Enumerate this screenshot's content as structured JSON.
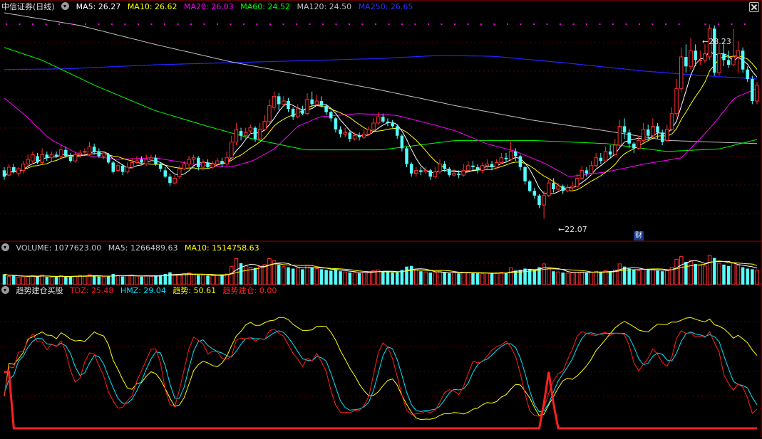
{
  "window": {
    "title": "中信证券(日线)"
  },
  "colors": {
    "up": "#ff3030",
    "down": "#54ffff",
    "ma5": "#ffffff",
    "ma10": "#ffff00",
    "ma20": "#ff00ff",
    "ma60": "#00ff00",
    "ma120": "#c0c0c0",
    "ma250": "#0000ff",
    "tdz": "#ff2020",
    "hmz": "#00e5ff",
    "qushi": "#ffff00",
    "jiancang": "#ff2020"
  },
  "price_panel": {
    "legend": [
      {
        "label": "MA5: 26.27",
        "color": "#ffffff"
      },
      {
        "label": "MA10: 26.62",
        "color": "#ffff00"
      },
      {
        "label": "MA20: 26.03",
        "color": "#ff00ff"
      },
      {
        "label": "MA60: 24.52",
        "color": "#00ff00"
      },
      {
        "label": "MA120: 24.50",
        "color": "#c0c0c0"
      },
      {
        "label": "MA250: 26.65",
        "color": "#2f2fff"
      }
    ],
    "high_label": "28.23",
    "low_label": "22.07",
    "cai_badge": "财"
  },
  "volume_panel": {
    "legend": [
      {
        "label": "VOLUME: 1077623.00",
        "color": "#c8c8c8"
      },
      {
        "label": "MA5: 1266489.63",
        "color": "#c8c8c8"
      },
      {
        "label": "MA10: 1514758.63",
        "color": "#ffff00"
      }
    ]
  },
  "indicator_panel": {
    "name": "趋势建仓买股",
    "legend": [
      {
        "label": "TDZ: 25.48",
        "color": "#ff2020"
      },
      {
        "label": "HMZ: 29.04",
        "color": "#00e5ff"
      },
      {
        "label": "趋势: 50.61",
        "color": "#ffff00"
      },
      {
        "label": "趋势建仓: 0.00",
        "color": "#ff2020"
      }
    ]
  },
  "chart_data": {
    "type": "candlestick",
    "title": "中信证券(日线)",
    "ylim": [
      21.6,
      28.6
    ],
    "candles": [
      [
        23.6,
        23.4,
        23.7,
        23.3
      ],
      [
        23.45,
        23.7,
        23.8,
        23.4
      ],
      [
        23.7,
        23.55,
        23.8,
        23.5
      ],
      [
        23.5,
        23.65,
        23.7,
        23.4
      ],
      [
        23.6,
        23.8,
        23.9,
        23.5
      ],
      [
        23.8,
        23.95,
        24.1,
        23.75
      ],
      [
        23.9,
        24.1,
        24.2,
        23.8
      ],
      [
        24.05,
        23.85,
        24.15,
        23.8
      ],
      [
        23.85,
        24.1,
        24.3,
        23.8
      ],
      [
        24.1,
        24.0,
        24.2,
        23.9
      ],
      [
        24.0,
        24.1,
        24.2,
        23.9
      ],
      [
        24.1,
        24.05,
        24.2,
        24.0
      ],
      [
        24.05,
        24.25,
        24.4,
        24.0
      ],
      [
        24.25,
        24.05,
        24.35,
        24.0
      ],
      [
        24.05,
        23.9,
        24.15,
        23.85
      ],
      [
        23.9,
        24.1,
        24.2,
        23.85
      ],
      [
        24.1,
        24.15,
        24.25,
        24.0
      ],
      [
        24.2,
        24.2,
        24.3,
        24.1
      ],
      [
        24.1,
        24.35,
        24.5,
        24.05
      ],
      [
        24.35,
        24.2,
        24.45,
        24.1
      ],
      [
        24.2,
        24.05,
        24.3,
        24.0
      ],
      [
        24.05,
        24.15,
        24.2,
        23.95
      ],
      [
        24.1,
        23.85,
        24.15,
        23.8
      ],
      [
        23.85,
        23.55,
        23.9,
        23.5
      ],
      [
        23.6,
        23.75,
        23.85,
        23.55
      ],
      [
        23.75,
        23.55,
        23.8,
        23.45
      ],
      [
        23.55,
        23.7,
        23.85,
        23.5
      ],
      [
        23.7,
        23.85,
        24.0,
        23.65
      ],
      [
        23.85,
        23.9,
        24.05,
        23.8
      ],
      [
        23.95,
        23.85,
        24.05,
        23.8
      ],
      [
        23.8,
        23.95,
        24.1,
        23.75
      ],
      [
        23.95,
        24.0,
        24.1,
        23.9
      ],
      [
        24.0,
        23.8,
        24.1,
        23.75
      ],
      [
        23.8,
        23.65,
        23.85,
        23.55
      ],
      [
        23.6,
        23.4,
        23.7,
        23.35
      ],
      [
        23.4,
        23.2,
        23.5,
        23.1
      ],
      [
        23.2,
        23.35,
        23.45,
        23.15
      ],
      [
        23.4,
        23.65,
        23.75,
        23.35
      ],
      [
        23.65,
        23.8,
        23.9,
        23.6
      ],
      [
        23.8,
        23.95,
        24.05,
        23.7
      ],
      [
        23.95,
        24.0,
        24.1,
        23.8
      ],
      [
        24.0,
        23.7,
        24.05,
        23.6
      ],
      [
        23.7,
        23.85,
        23.95,
        23.6
      ],
      [
        23.85,
        23.7,
        23.95,
        23.65
      ],
      [
        23.7,
        23.8,
        23.9,
        23.65
      ],
      [
        23.8,
        23.9,
        24.0,
        23.75
      ],
      [
        23.9,
        23.8,
        24.0,
        23.7
      ],
      [
        23.8,
        24.0,
        24.2,
        23.75
      ],
      [
        24.0,
        24.5,
        24.7,
        23.95
      ],
      [
        24.5,
        24.9,
        25.1,
        24.4
      ],
      [
        24.85,
        24.7,
        24.95,
        24.55
      ],
      [
        24.7,
        24.8,
        24.95,
        24.6
      ],
      [
        24.85,
        24.95,
        25.05,
        24.75
      ],
      [
        24.95,
        24.6,
        25.0,
        24.5
      ],
      [
        24.6,
        24.9,
        25.1,
        24.55
      ],
      [
        24.9,
        25.15,
        25.35,
        24.85
      ],
      [
        25.15,
        25.65,
        25.85,
        25.1
      ],
      [
        25.6,
        25.95,
        26.1,
        25.5
      ],
      [
        25.95,
        25.7,
        26.05,
        25.5
      ],
      [
        25.7,
        25.8,
        25.95,
        25.6
      ],
      [
        25.8,
        25.55,
        25.9,
        25.45
      ],
      [
        25.55,
        25.3,
        25.6,
        25.2
      ],
      [
        25.3,
        25.55,
        25.7,
        25.25
      ],
      [
        25.5,
        25.4,
        25.65,
        25.35
      ],
      [
        25.4,
        25.85,
        26.05,
        25.35
      ],
      [
        25.85,
        25.7,
        26.1,
        25.6
      ],
      [
        25.7,
        25.8,
        26.0,
        25.65
      ],
      [
        25.8,
        25.65,
        25.95,
        25.6
      ],
      [
        25.65,
        25.45,
        25.7,
        25.35
      ],
      [
        25.45,
        25.25,
        25.5,
        25.15
      ],
      [
        25.25,
        24.9,
        25.3,
        24.8
      ],
      [
        24.9,
        24.75,
        25.0,
        24.65
      ],
      [
        24.75,
        24.8,
        24.95,
        24.65
      ],
      [
        24.8,
        24.6,
        24.85,
        24.5
      ],
      [
        24.6,
        24.7,
        24.8,
        24.55
      ],
      [
        24.7,
        24.65,
        24.8,
        24.55
      ],
      [
        24.65,
        24.75,
        24.9,
        24.6
      ],
      [
        24.75,
        24.9,
        25.0,
        24.7
      ],
      [
        24.9,
        25.1,
        25.25,
        24.85
      ],
      [
        25.1,
        25.3,
        25.45,
        25.05
      ],
      [
        25.3,
        25.15,
        25.4,
        25.1
      ],
      [
        25.15,
        25.1,
        25.25,
        25.0
      ],
      [
        25.1,
        25.0,
        25.2,
        24.95
      ],
      [
        25.0,
        24.7,
        25.05,
        24.6
      ],
      [
        24.7,
        24.3,
        24.75,
        24.2
      ],
      [
        24.3,
        23.8,
        24.35,
        23.7
      ],
      [
        23.8,
        23.5,
        23.85,
        23.4
      ],
      [
        23.5,
        23.6,
        23.7,
        23.4
      ],
      [
        23.6,
        23.55,
        23.7,
        23.45
      ],
      [
        23.55,
        23.6,
        23.7,
        23.5
      ],
      [
        23.6,
        23.4,
        23.65,
        23.3
      ],
      [
        23.4,
        23.55,
        23.7,
        23.35
      ],
      [
        23.55,
        23.8,
        23.95,
        23.5
      ],
      [
        23.8,
        23.65,
        23.9,
        23.55
      ],
      [
        23.65,
        23.45,
        23.7,
        23.4
      ],
      [
        23.45,
        23.5,
        23.65,
        23.4
      ],
      [
        23.5,
        23.45,
        23.6,
        23.35
      ],
      [
        23.45,
        23.6,
        23.8,
        23.4
      ],
      [
        23.6,
        23.75,
        23.9,
        23.55
      ],
      [
        23.75,
        23.7,
        23.9,
        23.6
      ],
      [
        23.7,
        23.6,
        23.8,
        23.5
      ],
      [
        23.6,
        23.75,
        23.85,
        23.5
      ],
      [
        23.75,
        23.8,
        23.95,
        23.65
      ],
      [
        23.8,
        23.7,
        23.9,
        23.6
      ],
      [
        23.7,
        23.85,
        23.95,
        23.65
      ],
      [
        23.85,
        24.0,
        24.15,
        23.8
      ],
      [
        24.0,
        23.95,
        24.15,
        23.85
      ],
      [
        23.95,
        24.2,
        24.55,
        23.9
      ],
      [
        24.2,
        24.05,
        24.3,
        23.9
      ],
      [
        24.05,
        23.7,
        24.1,
        23.6
      ],
      [
        23.7,
        23.25,
        23.75,
        23.15
      ],
      [
        23.25,
        22.95,
        23.3,
        22.9
      ],
      [
        22.95,
        22.8,
        23.05,
        22.7
      ],
      [
        22.8,
        22.5,
        22.85,
        22.4
      ],
      [
        22.5,
        22.8,
        22.95,
        22.07
      ],
      [
        22.8,
        23.2,
        23.3,
        22.75
      ],
      [
        23.2,
        23.0,
        23.35,
        22.9
      ],
      [
        23.0,
        23.1,
        23.2,
        22.95
      ],
      [
        23.1,
        22.95,
        23.15,
        22.85
      ],
      [
        22.95,
        23.05,
        23.15,
        22.9
      ],
      [
        23.05,
        23.1,
        23.25,
        22.95
      ],
      [
        23.1,
        23.35,
        23.5,
        23.05
      ],
      [
        23.35,
        23.6,
        23.75,
        23.3
      ],
      [
        23.6,
        23.5,
        23.7,
        23.4
      ],
      [
        23.5,
        23.75,
        23.9,
        23.45
      ],
      [
        23.75,
        24.0,
        24.15,
        23.7
      ],
      [
        24.0,
        23.9,
        24.15,
        23.8
      ],
      [
        23.9,
        24.2,
        24.35,
        23.85
      ],
      [
        24.2,
        24.1,
        24.4,
        24.0
      ],
      [
        24.1,
        24.4,
        24.6,
        24.05
      ],
      [
        24.4,
        25.0,
        25.2,
        24.35
      ],
      [
        25.0,
        24.8,
        25.25,
        24.6
      ],
      [
        24.8,
        24.45,
        24.9,
        24.3
      ],
      [
        24.45,
        24.3,
        24.5,
        24.15
      ],
      [
        24.3,
        24.55,
        24.7,
        24.25
      ],
      [
        24.55,
        24.9,
        25.1,
        24.5
      ],
      [
        24.9,
        24.7,
        25.05,
        24.6
      ],
      [
        24.7,
        25.0,
        25.25,
        24.65
      ],
      [
        25.0,
        24.8,
        25.1,
        24.6
      ],
      [
        24.8,
        24.5,
        24.9,
        24.4
      ],
      [
        24.55,
        24.9,
        25.05,
        24.5
      ],
      [
        24.9,
        25.4,
        25.6,
        24.85
      ],
      [
        25.4,
        26.2,
        26.5,
        25.3
      ],
      [
        26.2,
        27.2,
        27.5,
        26.1
      ],
      [
        27.2,
        26.9,
        27.6,
        26.7
      ],
      [
        26.9,
        27.4,
        27.8,
        26.8
      ],
      [
        27.4,
        27.1,
        27.6,
        26.9
      ],
      [
        27.1,
        27.1,
        27.4,
        26.95
      ],
      [
        27.1,
        27.3,
        27.6,
        27.0
      ],
      [
        27.2,
        28.1,
        28.23,
        27.1
      ],
      [
        28.1,
        26.7,
        28.2,
        26.6
      ],
      [
        26.7,
        27.3,
        27.6,
        26.6
      ],
      [
        27.3,
        27.1,
        27.6,
        26.9
      ],
      [
        27.1,
        26.95,
        27.4,
        26.85
      ],
      [
        26.95,
        27.2,
        28.1,
        26.9
      ],
      [
        27.2,
        27.4,
        27.7,
        26.7
      ],
      [
        27.4,
        26.8,
        27.5,
        26.7
      ],
      [
        26.8,
        26.5,
        26.9,
        26.4
      ],
      [
        26.5,
        25.8,
        26.6,
        25.7
      ],
      [
        25.8,
        26.3,
        26.4,
        25.7
      ]
    ],
    "volume": [
      0.78,
      0.62,
      0.7,
      0.55,
      0.58,
      0.62,
      0.68,
      0.6,
      0.72,
      0.58,
      0.55,
      0.62,
      0.66,
      0.6,
      0.58,
      0.64,
      0.7,
      0.66,
      0.75,
      0.62,
      0.6,
      0.58,
      0.64,
      0.8,
      0.7,
      0.62,
      0.66,
      0.7,
      0.64,
      0.6,
      0.68,
      0.62,
      0.66,
      0.72,
      0.8,
      0.92,
      0.7,
      0.76,
      0.82,
      0.88,
      0.76,
      0.72,
      0.7,
      0.68,
      0.66,
      0.7,
      0.72,
      0.8,
      1.35,
      1.95,
      1.6,
      1.4,
      1.3,
      1.25,
      1.35,
      1.5,
      1.95,
      1.8,
      1.5,
      1.35,
      1.3,
      1.2,
      1.25,
      1.15,
      1.45,
      1.3,
      1.2,
      1.15,
      1.1,
      1.05,
      1.15,
      1.0,
      0.95,
      0.9,
      0.88,
      0.85,
      0.9,
      0.95,
      1.05,
      1.1,
      1.0,
      0.95,
      0.9,
      0.92,
      1.1,
      1.35,
      1.4,
      1.1,
      1.0,
      0.95,
      0.9,
      0.88,
      1.0,
      0.92,
      0.85,
      0.88,
      0.84,
      0.9,
      0.92,
      0.88,
      0.85,
      0.82,
      0.86,
      0.84,
      0.88,
      0.92,
      0.86,
      1.25,
      1.05,
      1.1,
      1.2,
      1.15,
      1.1,
      1.3,
      1.55,
      1.2,
      1.0,
      0.95,
      0.9,
      0.86,
      0.88,
      0.92,
      0.95,
      0.9,
      0.94,
      1.0,
      0.92,
      1.05,
      1.0,
      1.1,
      1.55,
      1.35,
      1.2,
      1.1,
      1.05,
      1.15,
      1.1,
      1.15,
      1.05,
      1.0,
      1.05,
      1.3,
      1.9,
      2.1,
      1.7,
      1.8,
      1.55,
      1.45,
      1.4,
      2.2,
      2.0,
      1.6,
      1.5,
      1.4,
      1.6,
      1.45,
      1.3,
      1.2,
      1.15,
      1.08
    ],
    "ma_shapes": {
      "ma250": [
        [
          0,
          26.8
        ],
        [
          0.08,
          26.82
        ],
        [
          0.2,
          26.95
        ],
        [
          0.35,
          27.05
        ],
        [
          0.5,
          27.15
        ],
        [
          0.58,
          27.25
        ],
        [
          0.65,
          27.22
        ],
        [
          0.75,
          27.0
        ],
        [
          0.85,
          26.75
        ],
        [
          0.92,
          26.62
        ],
        [
          1.0,
          26.5
        ]
      ],
      "ma120": [
        [
          0,
          28.6
        ],
        [
          0.1,
          28.2
        ],
        [
          0.2,
          27.6
        ],
        [
          0.3,
          27.05
        ],
        [
          0.4,
          26.6
        ],
        [
          0.5,
          26.15
        ],
        [
          0.6,
          25.65
        ],
        [
          0.7,
          25.2
        ],
        [
          0.8,
          24.85
        ],
        [
          0.88,
          24.55
        ],
        [
          1.0,
          24.45
        ]
      ],
      "ma60": [
        [
          0,
          27.5
        ],
        [
          0.05,
          27.1
        ],
        [
          0.12,
          26.3
        ],
        [
          0.2,
          25.5
        ],
        [
          0.27,
          25.0
        ],
        [
          0.33,
          24.6
        ],
        [
          0.4,
          24.25
        ],
        [
          0.5,
          24.25
        ],
        [
          0.6,
          24.55
        ],
        [
          0.7,
          24.55
        ],
        [
          0.8,
          24.45
        ],
        [
          0.88,
          24.2
        ],
        [
          0.95,
          24.28
        ],
        [
          1.0,
          24.58
        ]
      ],
      "ma20": [
        [
          0,
          25.9
        ],
        [
          0.03,
          25.3
        ],
        [
          0.06,
          24.6
        ],
        [
          0.1,
          24.1
        ],
        [
          0.15,
          23.95
        ],
        [
          0.2,
          24.0
        ],
        [
          0.25,
          23.8
        ],
        [
          0.3,
          23.7
        ],
        [
          0.33,
          23.9
        ],
        [
          0.36,
          24.3
        ],
        [
          0.39,
          25.0
        ],
        [
          0.42,
          25.3
        ],
        [
          0.47,
          25.4
        ],
        [
          0.52,
          25.35
        ],
        [
          0.57,
          25.05
        ],
        [
          0.6,
          24.85
        ],
        [
          0.64,
          24.45
        ],
        [
          0.68,
          24.2
        ],
        [
          0.72,
          23.8
        ],
        [
          0.75,
          23.4
        ],
        [
          0.8,
          23.55
        ],
        [
          0.85,
          23.8
        ],
        [
          0.9,
          24.0
        ],
        [
          0.94,
          25.0
        ],
        [
          0.97,
          25.9
        ],
        [
          1.0,
          26.2
        ]
      ]
    }
  }
}
